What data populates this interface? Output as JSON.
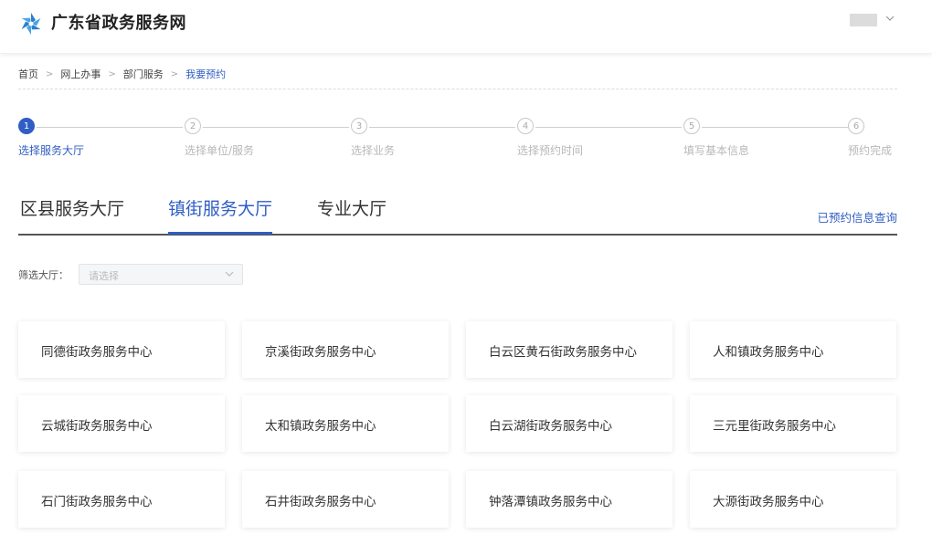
{
  "header": {
    "site_title": "广东省政务服务网",
    "logo_icon": "pinwheel-logo-icon",
    "user_chevron_icon": "chevron-down-icon"
  },
  "breadcrumb": [
    "首页",
    "网上办事",
    "部门服务",
    "我要预约"
  ],
  "steps": [
    {
      "num": "1",
      "label": "选择服务大厅",
      "active": true
    },
    {
      "num": "2",
      "label": "选择单位/服务",
      "active": false
    },
    {
      "num": "3",
      "label": "选择业务",
      "active": false
    },
    {
      "num": "4",
      "label": "选择预约时间",
      "active": false
    },
    {
      "num": "5",
      "label": "填写基本信息",
      "active": false
    },
    {
      "num": "6",
      "label": "预约完成",
      "active": false
    }
  ],
  "tabs": [
    {
      "label": "区县服务大厅",
      "active": false
    },
    {
      "label": "镇街服务大厅",
      "active": true
    },
    {
      "label": "专业大厅",
      "active": false
    }
  ],
  "query_link": "已预约信息查询",
  "filter": {
    "label": "筛选大厅：",
    "placeholder": "请选择"
  },
  "halls": [
    "同德街政务服务中心",
    "京溪街政务服务中心",
    "白云区黄石街政务服务中心",
    "人和镇政务服务中心",
    "云城街政务服务中心",
    "太和镇政务服务中心",
    "白云湖街政务服务中心",
    "三元里街政务服务中心",
    "石门街政务服务中心",
    "石井街政务服务中心",
    "钟落潭镇政务服务中心",
    "大源街政务服务中心"
  ],
  "colors": {
    "accent": "#2f5ec4",
    "logo": "#3a8fd8"
  }
}
